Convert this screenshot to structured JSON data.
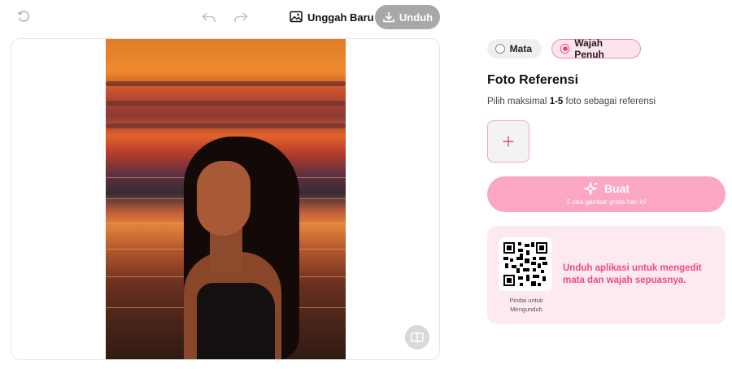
{
  "toolbar": {
    "upload_label": "Unggah Baru",
    "download_label": "Unduh"
  },
  "modes": {
    "eye_label": "Mata",
    "face_label": "Wajah Penuh",
    "selected": "Wajah Penuh"
  },
  "reference": {
    "title": "Foto Referensi",
    "desc_before": "Pilih maksimal ",
    "desc_range": "1-5",
    "desc_after": " foto sebagai referensi"
  },
  "generate": {
    "label": "Buat",
    "sub_label": "2 sisa gambar gratis hari ini"
  },
  "promo": {
    "qr_caption_line1": "Pindai untuk",
    "qr_caption_line2": "Mengunduh",
    "text": "Unduh aplikasi untuk mengedit mata dan wajah sepuasnya."
  },
  "colors": {
    "accent_pink": "#e8487a",
    "button_pink": "#fba6c4",
    "promo_bg": "#fdeaf0",
    "download_gray": "#a8a8a8"
  }
}
